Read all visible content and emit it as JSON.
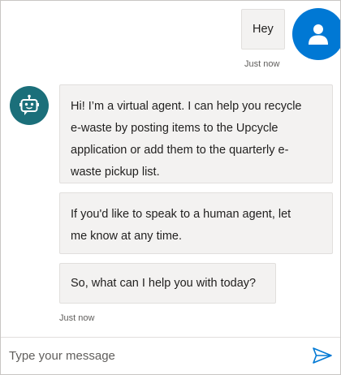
{
  "colors": {
    "user_avatar": "#0078d4",
    "bot_avatar": "#1b6f7a",
    "bubble_bg": "#f3f2f1",
    "send_icon": "#0078d4"
  },
  "messages": {
    "user": {
      "text": "Hey",
      "timestamp": "Just now",
      "avatar_icon": "person-icon"
    },
    "bot": {
      "avatar_icon": "robot-icon",
      "bubble1_lines": [
        "Hi! I’m a virtual agent. I can help you recycle",
        "e-waste by posting items to the Upcycle",
        "application or add them to the quarterly e-",
        "waste pickup list."
      ],
      "bubble2_lines": [
        "If you'd like to speak to a human agent, let",
        "me know at any time."
      ],
      "bubble3_lines": [
        "So, what can I help you with today?"
      ],
      "timestamp": "Just now"
    }
  },
  "composer": {
    "placeholder": "Type your message",
    "value": "",
    "send_icon": "send-icon"
  }
}
